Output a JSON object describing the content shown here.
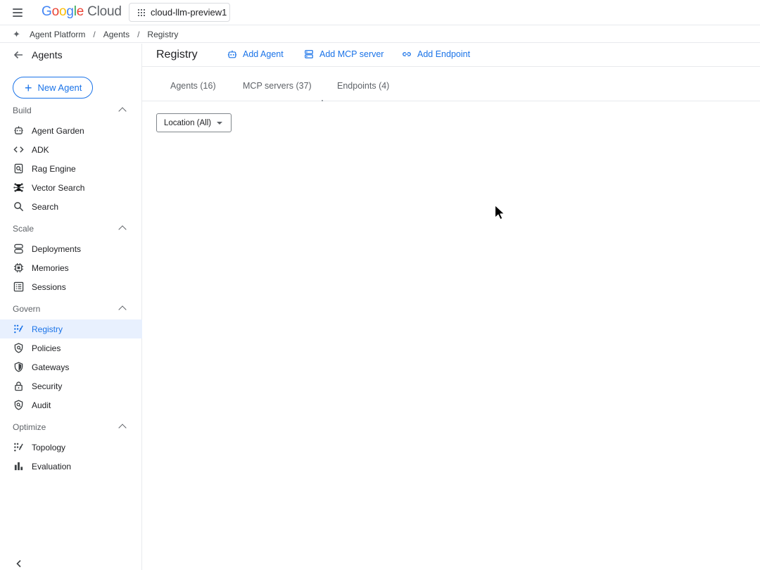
{
  "header": {
    "logo_letters": [
      "G",
      "o",
      "o",
      "g",
      "l",
      "e"
    ],
    "logo_suffix": "Cloud",
    "project": "cloud-llm-preview1"
  },
  "breadcrumb": {
    "items": [
      "Agent Platform",
      "Agents",
      "Registry"
    ],
    "separator": "/"
  },
  "sidebar": {
    "title": "Agents",
    "new_agent_label": "New Agent",
    "sections": [
      {
        "label": "Build",
        "items": [
          {
            "label": "Agent Garden",
            "icon": "agent-garden-icon"
          },
          {
            "label": "ADK",
            "icon": "code-icon"
          },
          {
            "label": "Rag Engine",
            "icon": "rag-engine-icon"
          },
          {
            "label": "Vector Search",
            "icon": "vector-search-icon"
          },
          {
            "label": "Search",
            "icon": "search-icon"
          }
        ]
      },
      {
        "label": "Scale",
        "items": [
          {
            "label": "Deployments",
            "icon": "deployments-icon"
          },
          {
            "label": "Memories",
            "icon": "memories-icon"
          },
          {
            "label": "Sessions",
            "icon": "sessions-icon"
          }
        ]
      },
      {
        "label": "Govern",
        "items": [
          {
            "label": "Registry",
            "icon": "registry-icon",
            "active": true
          },
          {
            "label": "Policies",
            "icon": "policies-icon"
          },
          {
            "label": "Gateways",
            "icon": "gateways-icon"
          },
          {
            "label": "Security",
            "icon": "lock-icon"
          },
          {
            "label": "Audit",
            "icon": "audit-icon"
          }
        ]
      },
      {
        "label": "Optimize",
        "items": [
          {
            "label": "Topology",
            "icon": "topology-icon"
          },
          {
            "label": "Evaluation",
            "icon": "bar-chart-icon"
          }
        ]
      }
    ]
  },
  "main": {
    "title": "Registry",
    "actions": [
      {
        "label": "Add Agent",
        "icon": "robot-icon"
      },
      {
        "label": "Add MCP server",
        "icon": "server-icon"
      },
      {
        "label": "Add Endpoint",
        "icon": "link-icon"
      }
    ],
    "tabs": [
      "Agents (16)",
      "MCP servers (37)",
      "Endpoints (4)"
    ],
    "filter_label": "Location (All)"
  },
  "colors": {
    "accent": "#1a73e8",
    "active_bg": "#e8f0fe",
    "text": "#202124",
    "muted": "#5f6368",
    "border": "#e8eaed"
  }
}
